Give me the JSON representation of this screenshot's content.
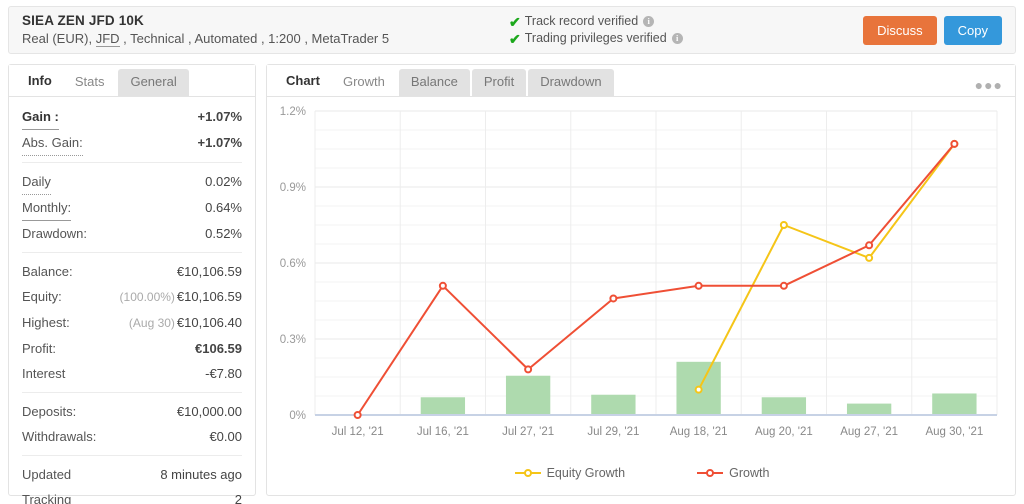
{
  "header": {
    "title": "SIEA ZEN JFD 10K",
    "subtitle_parts": [
      "Real (EUR),",
      "JFD",
      ", Technical , Automated , 1:200 , MetaTrader 5"
    ],
    "verify": [
      {
        "label": "Track record verified",
        "icon": "info-icon",
        "check": "✔"
      },
      {
        "label": "Trading privileges verified",
        "icon": "info-icon",
        "check": "✔"
      }
    ],
    "discuss_label": "Discuss",
    "copy_label": "Copy",
    "discuss_color": "#e8743b",
    "copy_color": "#3498db"
  },
  "left_panel": {
    "tab_label": "Info",
    "tabs": [
      {
        "label": "Stats",
        "active": true
      },
      {
        "label": "General",
        "active": false
      }
    ],
    "groups": [
      {
        "rows": [
          {
            "key": "Gain :",
            "value": "+1.07%",
            "value_style": "green",
            "key_style": "bold solid"
          },
          {
            "key": "Abs. Gain:",
            "value": "+1.07%",
            "value_style": "green",
            "key_style": "dot"
          }
        ]
      },
      {
        "rows": [
          {
            "key": "Daily",
            "value": "0.02%",
            "key_style": "dot"
          },
          {
            "key": "Monthly:",
            "value": "0.64%",
            "key_style": "solid"
          },
          {
            "key": "Drawdown:",
            "value": "0.52%",
            "key_style": "none"
          }
        ]
      },
      {
        "rows": [
          {
            "key": "Balance:",
            "value": "€10,106.59",
            "key_style": "none"
          },
          {
            "key": "Equity:",
            "value": "€10,106.59",
            "sub": "(100.00%)",
            "key_style": "none"
          },
          {
            "key": "Highest:",
            "value": "€10,106.40",
            "sub": "(Aug 30)",
            "key_style": "none"
          },
          {
            "key": "Profit:",
            "value": "€106.59",
            "value_style": "green",
            "key_style": "none"
          },
          {
            "key": "Interest",
            "value": "-€7.80",
            "key_style": "none"
          }
        ]
      },
      {
        "rows": [
          {
            "key": "Deposits:",
            "value": "€10,000.00",
            "key_style": "none"
          },
          {
            "key": "Withdrawals:",
            "value": "€0.00",
            "key_style": "none"
          }
        ]
      },
      {
        "rows": [
          {
            "key": "Updated",
            "value": "8 minutes ago",
            "key_style": "none"
          },
          {
            "key": "Tracking",
            "value": "2",
            "key_style": "none"
          }
        ]
      }
    ]
  },
  "right_panel": {
    "tab_label": "Chart",
    "tabs": [
      {
        "label": "Growth",
        "active": true
      },
      {
        "label": "Balance",
        "active": false
      },
      {
        "label": "Profit",
        "active": false
      },
      {
        "label": "Drawdown",
        "active": false
      }
    ],
    "menu_icon": "ellipsis-icon",
    "menu_glyph": "●●●"
  },
  "chart_data": {
    "type": "line",
    "title": "",
    "xlabel": "",
    "ylabel": "",
    "categories": [
      "Jul 12, '21",
      "Jul 16, '21",
      "Jul 27, '21",
      "Jul 29, '21",
      "Aug 18, '21",
      "Aug 20, '21",
      "Aug 27, '21",
      "Aug 30, '21"
    ],
    "ylim": [
      0,
      1.2
    ],
    "yticks": [
      0,
      0.3,
      0.6,
      0.9,
      1.2
    ],
    "ytick_labels": [
      "0%",
      "0.3%",
      "0.6%",
      "0.9%",
      "1.2%"
    ],
    "grid": true,
    "legend_position": "bottom",
    "series": [
      {
        "name": "Equity Growth",
        "type": "line",
        "color": "#f5c518",
        "values": [
          null,
          null,
          null,
          null,
          0.1,
          0.75,
          0.62,
          1.07
        ]
      },
      {
        "name": "Growth",
        "type": "line",
        "color": "#ef4f35",
        "values": [
          0.0,
          0.51,
          0.18,
          0.46,
          0.51,
          0.51,
          0.67,
          1.07
        ]
      },
      {
        "name": "Bars",
        "type": "bar",
        "color": "#aedaae",
        "show_in_legend": false,
        "values": [
          0.0,
          0.07,
          0.155,
          0.08,
          0.21,
          0.07,
          0.045,
          0.085
        ]
      }
    ]
  }
}
